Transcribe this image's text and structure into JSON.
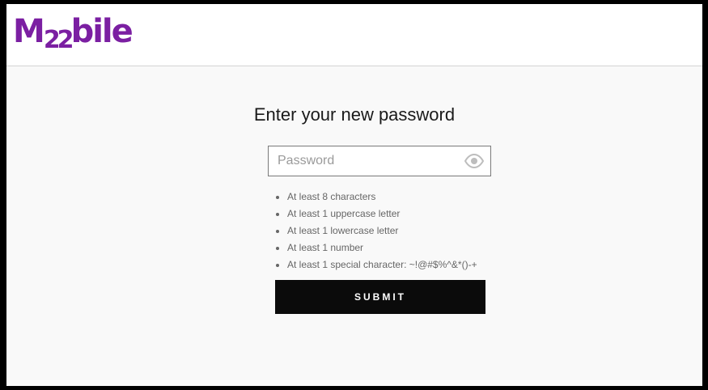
{
  "brand": {
    "logo_prefix": "M",
    "logo_digits": "22",
    "logo_suffix": "bile",
    "color": "#7b1fa2"
  },
  "form": {
    "title": "Enter your new password",
    "password": {
      "value": "",
      "placeholder": "Password",
      "toggle_icon": "eye-icon"
    },
    "requirements": [
      "At least 8 characters",
      "At least 1 uppercase letter",
      "At least 1 lowercase letter",
      "At least 1 number",
      "At least 1 special character: ~!@#$%^&*()-+"
    ],
    "submit_label": "SUBMIT"
  }
}
